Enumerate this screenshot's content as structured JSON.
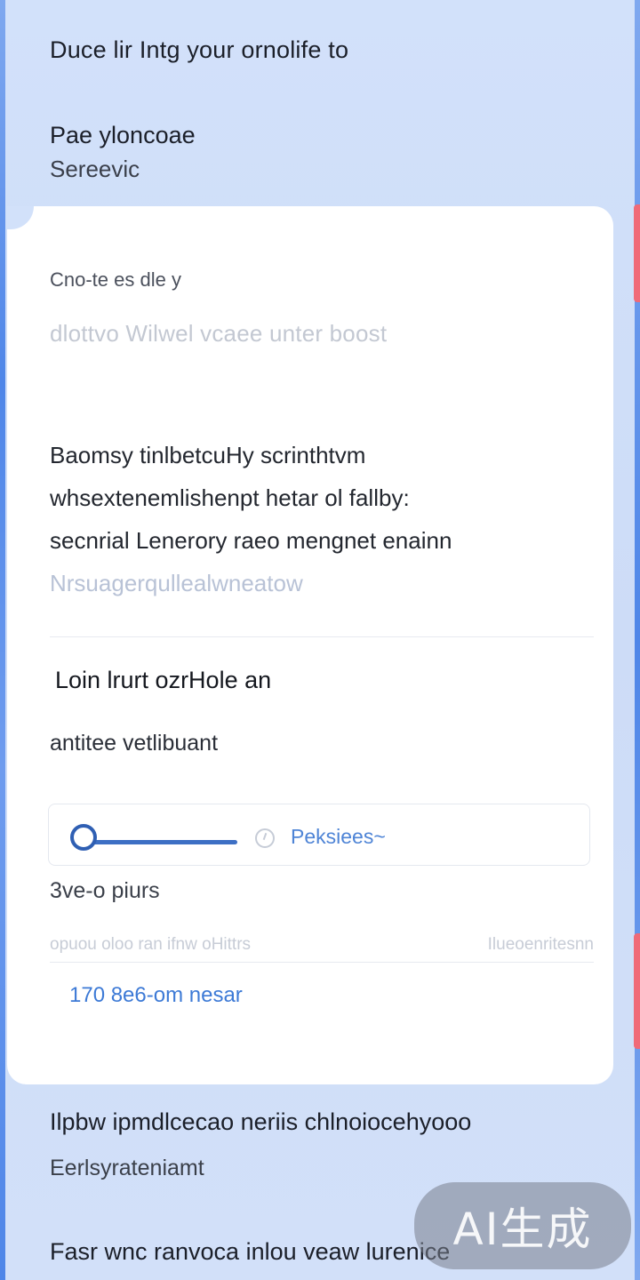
{
  "header": {
    "heading": "Duce lir Intg your ornolife to",
    "subtitle": "Pae yloncoae",
    "caption": "Sereevic"
  },
  "card": {
    "field_label": "Cno-te es dle y",
    "field_placeholder": "dlottvo Wilwel vcaee unter boost",
    "paragraph": [
      "Baomsy tinlbetcuHy scrinthtvm",
      "whsextenemlishenpt hetar ol fallby:",
      "secnrial Lenerory raeo mengnet enainn",
      "Nrsuagerqullealwneatow"
    ],
    "section_title": "Loin lrurt ozrHole an",
    "section_subtitle": "antitee vetlibuant",
    "slider": {
      "value": 0.0,
      "link_label": "Peksiees~"
    },
    "option_label": "3ve-o piurs",
    "option_hints": [
      "opuou oloo ran ifnw oHittrs",
      "Ilueoenritesnn"
    ],
    "option_value": "170 8e6-om nesar"
  },
  "footer": {
    "title": "Ilpbw ipmdlcecao neriis chlnoiocehyooo",
    "subtitle": "Eerlsyrateniamt",
    "foot": "Fasr wnc ranvoca inlou veaw lurenice"
  },
  "watermark": "AI生成",
  "colors": {
    "background": "#d2e1fa",
    "card": "#ffffff",
    "accent": "#3d7ad6",
    "edge_accent": "#f06a78"
  }
}
